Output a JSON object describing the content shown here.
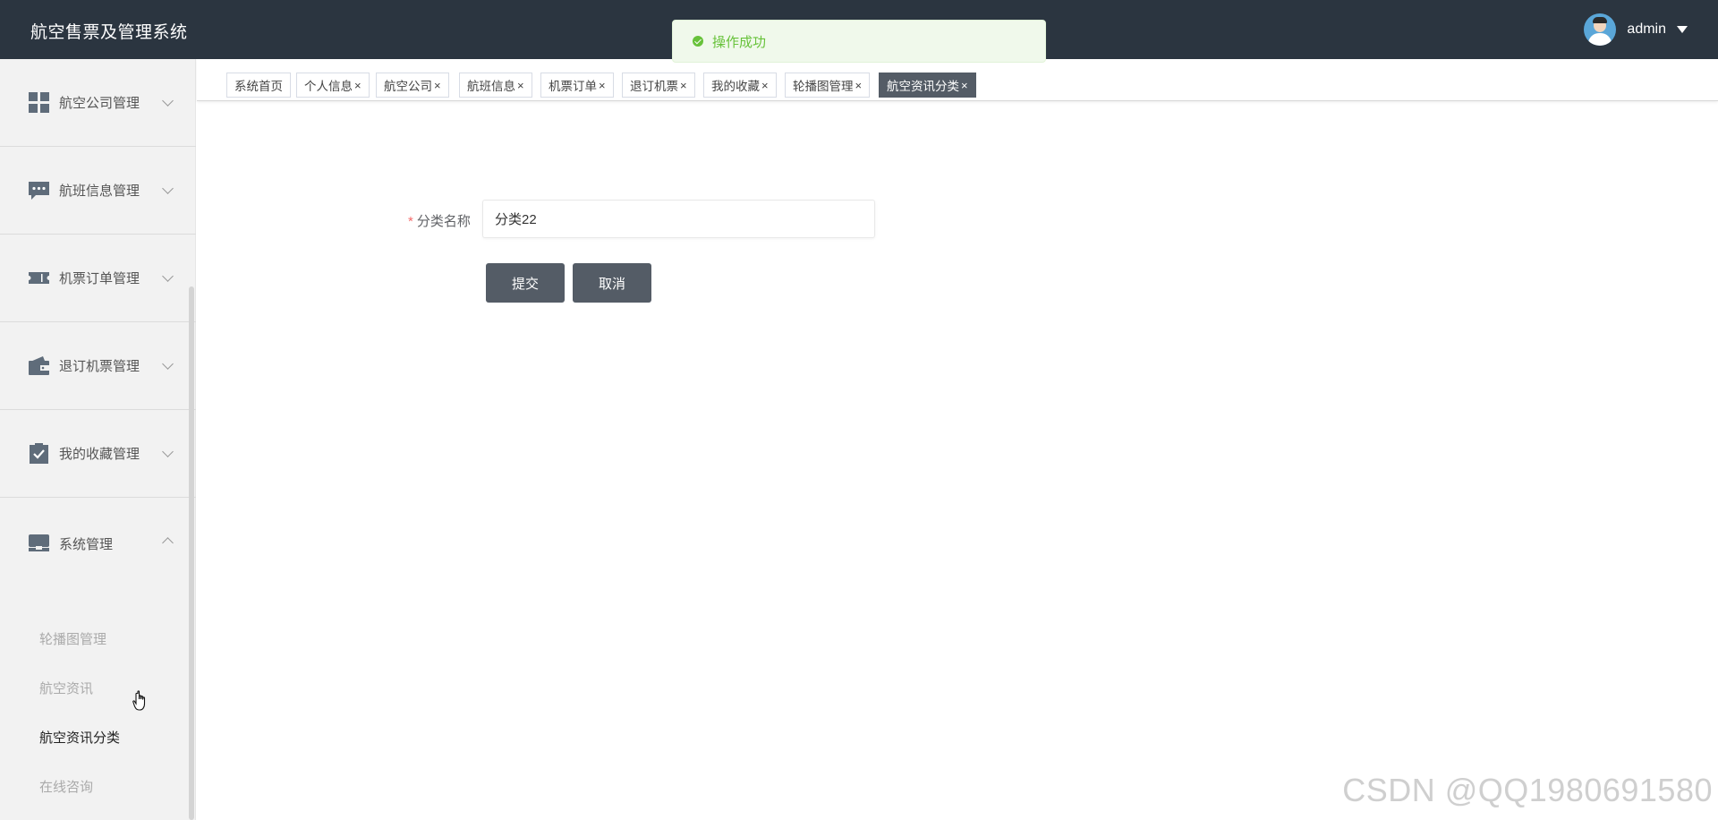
{
  "header": {
    "app_title": "航空售票及管理系统",
    "username": "admin"
  },
  "toast": {
    "message": "操作成功",
    "type": "success"
  },
  "sidebar": {
    "groups": [
      {
        "label": "航空公司管理",
        "icon": "grid-icon",
        "expanded": false
      },
      {
        "label": "航班信息管理",
        "icon": "chat-dots-icon",
        "expanded": false
      },
      {
        "label": "机票订单管理",
        "icon": "ticket-icon",
        "expanded": false
      },
      {
        "label": "退订机票管理",
        "icon": "wallet-icon",
        "expanded": false
      },
      {
        "label": "我的收藏管理",
        "icon": "clipboard-check-icon",
        "expanded": false
      },
      {
        "label": "系统管理",
        "icon": "monitor-icon",
        "expanded": true
      }
    ],
    "subitems": [
      {
        "label": "轮播图管理",
        "active": false
      },
      {
        "label": "航空资讯",
        "active": false
      },
      {
        "label": "航空资讯分类",
        "active": true
      },
      {
        "label": "在线咨询",
        "active": false
      }
    ]
  },
  "tabs": [
    {
      "label": "系统首页",
      "closable": false,
      "active": false
    },
    {
      "label": "个人信息",
      "closable": true,
      "active": false
    },
    {
      "label": "航空公司",
      "closable": true,
      "active": false
    },
    {
      "label": "航班信息",
      "closable": true,
      "active": false
    },
    {
      "label": "机票订单",
      "closable": true,
      "active": false
    },
    {
      "label": "退订机票",
      "closable": true,
      "active": false
    },
    {
      "label": "我的收藏",
      "closable": true,
      "active": false
    },
    {
      "label": "轮播图管理",
      "closable": true,
      "active": false
    },
    {
      "label": "航空资讯分类",
      "closable": true,
      "active": true
    }
  ],
  "tab_close_glyph": "×",
  "form": {
    "required_mark": "*",
    "category_label": "分类名称",
    "category_value": "分类22",
    "submit_label": "提交",
    "cancel_label": "取消"
  },
  "watermark": "CSDN @QQ1980691580",
  "colors": {
    "header_bg": "#2b3540",
    "primary_button": "#545c66",
    "success": "#67c23a",
    "required": "#f56c6c"
  }
}
